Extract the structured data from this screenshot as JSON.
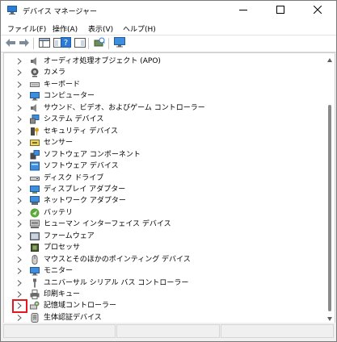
{
  "window": {
    "title": "デバイス マネージャー",
    "app_icon": "device-manager-icon"
  },
  "menu": [
    {
      "label": "ファイル(F)"
    },
    {
      "label": "操作(A)"
    },
    {
      "label": "表示(V)"
    },
    {
      "label": "ヘルプ(H)"
    }
  ],
  "toolbar": [
    "back-arrow-icon",
    "forward-arrow-icon",
    "properties-grid-icon",
    "console-tree-icon",
    "help-icon",
    "action-pane-icon",
    "scan-hardware-icon",
    "monitor-icon"
  ],
  "tree": {
    "items": [
      {
        "label": "オーディオ処理オブジェクト (APO)",
        "icon": "speaker-icon"
      },
      {
        "label": "カメラ",
        "icon": "camera-icon"
      },
      {
        "label": "キーボード",
        "icon": "keyboard-icon"
      },
      {
        "label": "コンピューター",
        "icon": "computer-icon"
      },
      {
        "label": "サウンド、ビデオ、およびゲーム コントローラー",
        "icon": "speaker-icon"
      },
      {
        "label": "システム デバイス",
        "icon": "system-devices-icon"
      },
      {
        "label": "セキュリティ デバイス",
        "icon": "security-key-icon"
      },
      {
        "label": "センサー",
        "icon": "sensor-icon"
      },
      {
        "label": "ソフトウェア コンポーネント",
        "icon": "software-component-icon"
      },
      {
        "label": "ソフトウェア デバイス",
        "icon": "software-device-icon"
      },
      {
        "label": "ディスク ドライブ",
        "icon": "disk-drive-icon"
      },
      {
        "label": "ディスプレイ アダプター",
        "icon": "display-adapter-icon"
      },
      {
        "label": "ネットワーク アダプター",
        "icon": "network-adapter-icon"
      },
      {
        "label": "バッテリ",
        "icon": "battery-icon"
      },
      {
        "label": "ヒューマン インターフェイス デバイス",
        "icon": "hid-icon"
      },
      {
        "label": "ファームウェア",
        "icon": "firmware-icon"
      },
      {
        "label": "プロセッサ",
        "icon": "processor-icon"
      },
      {
        "label": "マウスとそのほかのポインティング デバイス",
        "icon": "mouse-icon"
      },
      {
        "label": "モニター",
        "icon": "monitor-icon"
      },
      {
        "label": "ユニバーサル シリアル バス コントローラー",
        "icon": "usb-icon"
      },
      {
        "label": "印刷キュー",
        "icon": "printer-icon"
      },
      {
        "label": "記憶域コントローラー",
        "icon": "storage-controller-icon",
        "highlighted": true
      },
      {
        "label": "生体認証デバイス",
        "icon": "biometric-icon"
      }
    ]
  },
  "colors": {
    "highlight_box": "#e8161d",
    "accent_blue": "#2a7ad6"
  }
}
